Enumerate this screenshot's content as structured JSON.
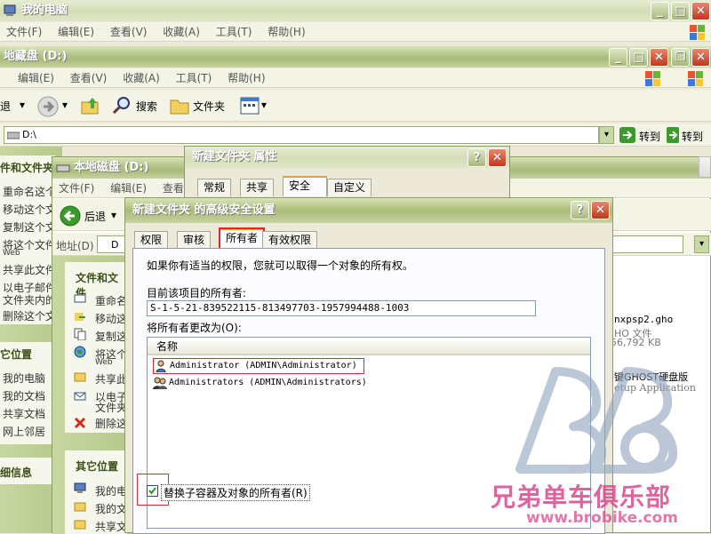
{
  "win1": {
    "title": "我的电脑",
    "menu": [
      "文件(F)",
      "编辑(E)",
      "查看(V)",
      "收藏(A)",
      "工具(T)",
      "帮助(H)"
    ]
  },
  "win2": {
    "title": "地藏盘 (D:)",
    "menu": [
      "编辑(E)",
      "查看(V)",
      "收藏(A)",
      "工具(T)",
      "帮助(H)"
    ],
    "back_label": "退",
    "search_label": "搜索",
    "folders_label": "文件夹",
    "address_value": "D:\\",
    "go_label": "转到",
    "go_label2": "转到",
    "side_head": "件和文件夹",
    "side_items": [
      "重命名这个",
      "移动这个文",
      "复制这个文",
      "将这个文件",
      "Web",
      "共享此文件",
      "以电子邮件",
      "文件夹内的",
      "删除这个文"
    ],
    "places_head": "它位置",
    "places_items": [
      "我的电脑",
      "我的文档",
      "共享文档",
      "网上邻居"
    ],
    "details_head": "细信息"
  },
  "win3": {
    "title": "本地磁盘 (D:)",
    "menu": [
      "文件(F)",
      "编辑(E)",
      "查看"
    ],
    "back_label": "后退",
    "address_label": "地址(D)",
    "task_head": "文件和文件",
    "task_items": [
      "重命名",
      "移动这",
      "复制这",
      "将这个",
      "Web",
      "共享此",
      "以电子",
      "文件夹",
      "删除这"
    ],
    "places_head": "其它位置",
    "places_items": [
      "我的电",
      "我的文",
      "共享文"
    ]
  },
  "files": {
    "line1": "nxpsp2.gho",
    "line2": "HO 文件",
    "line3": "56,792 KB",
    "line4": "键GHOST硬盘版",
    "line5": "etup Application"
  },
  "props": {
    "title": "新建文件夹 属性",
    "tabs": [
      "常规",
      "共享",
      "安全",
      "自定义"
    ]
  },
  "adv": {
    "title": "新建文件夹 的高级安全设置",
    "tabs": [
      "权限",
      "审核",
      "所有者",
      "有效权限"
    ],
    "info": "如果你有适当的权限，您就可以取得一个对象的所有权。",
    "current_owner_label": "目前该项目的所有者:",
    "current_owner_value": "S-1-5-21-839522115-813497703-1957994488-1003",
    "change_to_label": "将所有者更改为(O):",
    "column_name": "名称",
    "owners": [
      "Administrator (ADMIN\\Administrator)",
      "Administrators (ADMIN\\Administrators)"
    ],
    "replace_label": "替换子容器及对象的所有者(R)",
    "replace_checked": true
  },
  "watermark": {
    "name": "兄弟单车俱乐部",
    "url": "www.brobike.com"
  },
  "colors": {
    "accent_olive": "#a9bb78",
    "highlight_red": "#e0262a",
    "active_tab": "#e6a33b"
  }
}
